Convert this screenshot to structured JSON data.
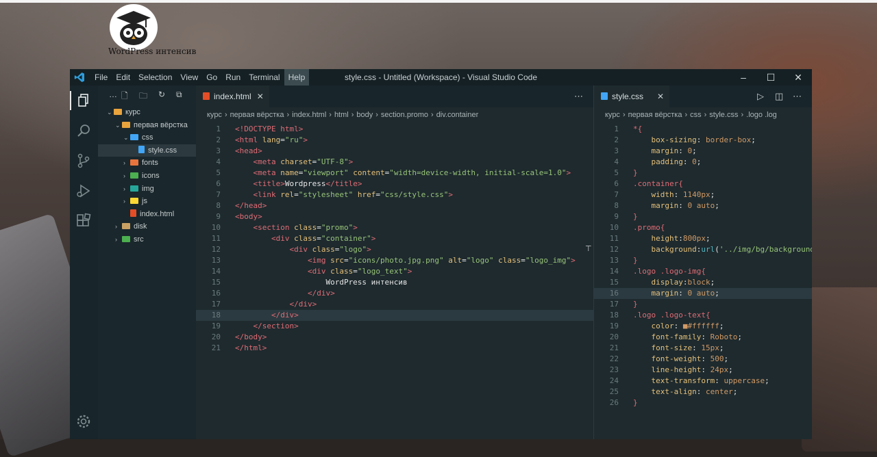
{
  "webpage": {
    "logo_text": "WordPress интенсив"
  },
  "window": {
    "title": "style.css - Untitled (Workspace) - Visual Studio Code",
    "menu": [
      "File",
      "Edit",
      "Selection",
      "View",
      "Go",
      "Run",
      "Terminal",
      "Help"
    ],
    "controls": [
      "minimize-icon",
      "maximize-icon",
      "close-icon"
    ]
  },
  "activity_bar": [
    "explorer-icon",
    "search-icon",
    "source-control-icon",
    "run-debug-icon",
    "extensions-icon",
    "settings-gear-icon"
  ],
  "sidebar": {
    "toolbar": [
      "more-actions-icon",
      "new-file-icon",
      "new-folder-icon",
      "refresh-icon",
      "collapse-all-icon"
    ],
    "tree": [
      {
        "label": "курс",
        "chev": "⌄",
        "indent": 0,
        "type": "folder",
        "color": "#e8a33d"
      },
      {
        "label": "первая вёрстка",
        "chev": "⌄",
        "indent": 1,
        "type": "folder",
        "color": "#e8a33d"
      },
      {
        "label": "css",
        "chev": "⌄",
        "indent": 2,
        "type": "folder",
        "color": "#42a5f5"
      },
      {
        "label": "style.css",
        "chev": "",
        "indent": 3,
        "type": "file",
        "color": "#42a5f5",
        "selected": true
      },
      {
        "label": "fonts",
        "chev": "›",
        "indent": 2,
        "type": "folder",
        "color": "#e8743d"
      },
      {
        "label": "icons",
        "chev": "›",
        "indent": 2,
        "type": "folder",
        "color": "#4caf50"
      },
      {
        "label": "img",
        "chev": "›",
        "indent": 2,
        "type": "folder",
        "color": "#26a69a"
      },
      {
        "label": "js",
        "chev": "›",
        "indent": 2,
        "type": "folder",
        "color": "#fdd835"
      },
      {
        "label": "index.html",
        "chev": "",
        "indent": 2,
        "type": "file",
        "color": "#e44d26"
      },
      {
        "label": "disk",
        "chev": "›",
        "indent": 1,
        "type": "folder",
        "color": "#c9a063"
      },
      {
        "label": "src",
        "chev": "›",
        "indent": 1,
        "type": "folder",
        "color": "#4caf50"
      }
    ]
  },
  "editor_left": {
    "tab_label": "index.html",
    "breadcrumb": [
      "курс",
      "первая вёрстка",
      "index.html",
      "html",
      "body",
      "section.promo",
      "div.container"
    ],
    "lines": [
      [
        [
          "t-tag",
          "<!DOCTYPE html>"
        ]
      ],
      [
        [
          "t-tag",
          "<html "
        ],
        [
          "t-attr",
          "lang"
        ],
        [
          "t-text",
          "="
        ],
        [
          "t-str",
          "\"ru\""
        ],
        [
          "t-tag",
          ">"
        ]
      ],
      [
        [
          "t-tag",
          "<head>"
        ]
      ],
      [
        [
          "t-text",
          "    "
        ],
        [
          "t-tag",
          "<meta "
        ],
        [
          "t-attr",
          "charset"
        ],
        [
          "t-text",
          "="
        ],
        [
          "t-str",
          "\"UTF-8\""
        ],
        [
          "t-tag",
          ">"
        ]
      ],
      [
        [
          "t-text",
          "    "
        ],
        [
          "t-tag",
          "<meta "
        ],
        [
          "t-attr",
          "name"
        ],
        [
          "t-text",
          "="
        ],
        [
          "t-str",
          "\"viewport\""
        ],
        [
          "t-text",
          " "
        ],
        [
          "t-attr",
          "content"
        ],
        [
          "t-text",
          "="
        ],
        [
          "t-str",
          "\"width=device-width, initial-scale=1.0\""
        ],
        [
          "t-tag",
          ">"
        ]
      ],
      [
        [
          "t-text",
          "    "
        ],
        [
          "t-tag",
          "<title>"
        ],
        [
          "t-text",
          "Wordpress"
        ],
        [
          "t-tag",
          "</title>"
        ]
      ],
      [
        [
          "t-text",
          "    "
        ],
        [
          "t-tag",
          "<link "
        ],
        [
          "t-attr",
          "rel"
        ],
        [
          "t-text",
          "="
        ],
        [
          "t-str",
          "\"stylesheet\""
        ],
        [
          "t-text",
          " "
        ],
        [
          "t-attr",
          "href"
        ],
        [
          "t-text",
          "="
        ],
        [
          "t-str",
          "\"css/style.css\""
        ],
        [
          "t-tag",
          ">"
        ]
      ],
      [
        [
          "t-tag",
          "</head>"
        ]
      ],
      [
        [
          "t-tag",
          "<body>"
        ]
      ],
      [
        [
          "t-text",
          "    "
        ],
        [
          "t-tag",
          "<section "
        ],
        [
          "t-attr",
          "class"
        ],
        [
          "t-text",
          "="
        ],
        [
          "t-str",
          "\"promo\""
        ],
        [
          "t-tag",
          ">"
        ]
      ],
      [
        [
          "t-text",
          "        "
        ],
        [
          "t-tag",
          "<div "
        ],
        [
          "t-attr",
          "class"
        ],
        [
          "t-text",
          "="
        ],
        [
          "t-str",
          "\"container\""
        ],
        [
          "t-tag",
          ">"
        ]
      ],
      [
        [
          "t-text",
          "            "
        ],
        [
          "t-tag",
          "<div "
        ],
        [
          "t-attr",
          "class"
        ],
        [
          "t-text",
          "="
        ],
        [
          "t-str",
          "\"logo\""
        ],
        [
          "t-tag",
          ">"
        ]
      ],
      [
        [
          "t-text",
          "                "
        ],
        [
          "t-tag",
          "<img "
        ],
        [
          "t-attr",
          "src"
        ],
        [
          "t-text",
          "="
        ],
        [
          "t-str",
          "\"icons/photo.jpg.png\""
        ],
        [
          "t-text",
          " "
        ],
        [
          "t-attr",
          "alt"
        ],
        [
          "t-text",
          "="
        ],
        [
          "t-str",
          "\"logo\""
        ],
        [
          "t-text",
          " "
        ],
        [
          "t-attr",
          "class"
        ],
        [
          "t-text",
          "="
        ],
        [
          "t-str",
          "\"logo_img\""
        ],
        [
          "t-tag",
          ">"
        ]
      ],
      [
        [
          "t-text",
          "                "
        ],
        [
          "t-tag",
          "<div "
        ],
        [
          "t-attr",
          "class"
        ],
        [
          "t-text",
          "="
        ],
        [
          "t-str",
          "\"logo_text\""
        ],
        [
          "t-tag",
          ">"
        ]
      ],
      [
        [
          "t-text",
          "                    WordPress интенсив"
        ]
      ],
      [
        [
          "t-text",
          "                "
        ],
        [
          "t-tag",
          "</div>"
        ]
      ],
      [
        [
          "t-text",
          "            "
        ],
        [
          "t-tag",
          "</div>"
        ]
      ],
      [
        [
          "t-text",
          "        "
        ],
        [
          "t-tag",
          "</div>"
        ]
      ],
      [
        [
          "t-text",
          "    "
        ],
        [
          "t-tag",
          "</section>"
        ]
      ],
      [
        [
          "t-tag",
          "</body>"
        ]
      ],
      [
        [
          "t-tag",
          "</html>"
        ]
      ]
    ]
  },
  "editor_right": {
    "tab_label": "style.css",
    "breadcrumb": [
      "курс",
      "первая вёрстка",
      "css",
      "style.css",
      ".logo .log"
    ],
    "lines": [
      [
        [
          "t-sel",
          "*{"
        ]
      ],
      [
        [
          "t-text",
          "    "
        ],
        [
          "t-prop",
          "box-sizing"
        ],
        [
          "t-text",
          ": "
        ],
        [
          "t-val",
          "border-box"
        ],
        [
          "t-text",
          ";"
        ]
      ],
      [
        [
          "t-text",
          "    "
        ],
        [
          "t-prop",
          "margin"
        ],
        [
          "t-text",
          ": "
        ],
        [
          "t-num",
          "0"
        ],
        [
          "t-text",
          ";"
        ]
      ],
      [
        [
          "t-text",
          "    "
        ],
        [
          "t-prop",
          "padding"
        ],
        [
          "t-text",
          ": "
        ],
        [
          "t-num",
          "0"
        ],
        [
          "t-text",
          ";"
        ]
      ],
      [
        [
          "t-sel",
          "}"
        ]
      ],
      [
        [
          "t-sel",
          ".container{"
        ]
      ],
      [
        [
          "t-text",
          "    "
        ],
        [
          "t-prop",
          "width"
        ],
        [
          "t-text",
          ": "
        ],
        [
          "t-num",
          "1140px"
        ],
        [
          "t-text",
          ";"
        ]
      ],
      [
        [
          "t-text",
          "    "
        ],
        [
          "t-prop",
          "margin"
        ],
        [
          "t-text",
          ": "
        ],
        [
          "t-num",
          "0"
        ],
        [
          "t-text",
          " "
        ],
        [
          "t-val",
          "auto"
        ],
        [
          "t-text",
          ";"
        ]
      ],
      [
        [
          "t-sel",
          "}"
        ]
      ],
      [
        [
          "t-sel",
          ".promo{"
        ]
      ],
      [
        [
          "t-text",
          "    "
        ],
        [
          "t-prop",
          "height"
        ],
        [
          "t-text",
          ":"
        ],
        [
          "t-num",
          "800px"
        ],
        [
          "t-text",
          ";"
        ]
      ],
      [
        [
          "t-text",
          "    "
        ],
        [
          "t-prop",
          "background"
        ],
        [
          "t-text",
          ":"
        ],
        [
          "t-kw",
          "url"
        ],
        [
          "t-text",
          "("
        ],
        [
          "t-str",
          "'../img/bg/background."
        ]
      ],
      [
        [
          "t-sel",
          "}"
        ]
      ],
      [
        [
          "t-sel",
          ".logo .logo-img{"
        ]
      ],
      [
        [
          "t-text",
          "    "
        ],
        [
          "t-prop",
          "display"
        ],
        [
          "t-text",
          ":"
        ],
        [
          "t-val",
          "block"
        ],
        [
          "t-text",
          ";"
        ]
      ],
      [
        [
          "t-text",
          "    "
        ],
        [
          "t-prop",
          "margin"
        ],
        [
          "t-text",
          ": "
        ],
        [
          "t-num",
          "0"
        ],
        [
          "t-text",
          " "
        ],
        [
          "t-val",
          "auto"
        ],
        [
          "t-text",
          ";"
        ]
      ],
      [
        [
          "t-sel",
          "}"
        ]
      ],
      [
        [
          "t-sel",
          ".logo .logo-text{"
        ]
      ],
      [
        [
          "t-text",
          "    "
        ],
        [
          "t-prop",
          "color"
        ],
        [
          "t-text",
          ": "
        ],
        [
          "t-val",
          "■#ffffff"
        ],
        [
          "t-text",
          ";"
        ]
      ],
      [
        [
          "t-text",
          "    "
        ],
        [
          "t-prop",
          "font-family"
        ],
        [
          "t-text",
          ": "
        ],
        [
          "t-val",
          "Roboto"
        ],
        [
          "t-text",
          ";"
        ]
      ],
      [
        [
          "t-text",
          "    "
        ],
        [
          "t-prop",
          "font-size"
        ],
        [
          "t-text",
          ": "
        ],
        [
          "t-num",
          "15px"
        ],
        [
          "t-text",
          ";"
        ]
      ],
      [
        [
          "t-text",
          "    "
        ],
        [
          "t-prop",
          "font-weight"
        ],
        [
          "t-text",
          ": "
        ],
        [
          "t-num",
          "500"
        ],
        [
          "t-text",
          ";"
        ]
      ],
      [
        [
          "t-text",
          "    "
        ],
        [
          "t-prop",
          "line-height"
        ],
        [
          "t-text",
          ": "
        ],
        [
          "t-num",
          "24px"
        ],
        [
          "t-text",
          ";"
        ]
      ],
      [
        [
          "t-text",
          "    "
        ],
        [
          "t-prop",
          "text-transform"
        ],
        [
          "t-text",
          ": "
        ],
        [
          "t-val",
          "uppercase"
        ],
        [
          "t-text",
          ";"
        ]
      ],
      [
        [
          "t-text",
          "    "
        ],
        [
          "t-prop",
          "text-align"
        ],
        [
          "t-text",
          ": "
        ],
        [
          "t-val",
          "center"
        ],
        [
          "t-text",
          ";"
        ]
      ],
      [
        [
          "t-sel",
          "}"
        ]
      ]
    ]
  },
  "colors": {
    "accent": "#42a5f5",
    "html_icon": "#e44d26",
    "editor_bg": "#1e2a2e"
  }
}
